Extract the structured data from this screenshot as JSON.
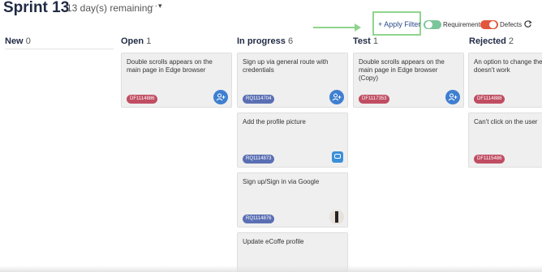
{
  "header": {
    "sprint": "Sprint 13",
    "remaining": "13 day(s) remaining",
    "menu_icon": "ellipsis-icon",
    "caret_icon": "caret-down-icon"
  },
  "toolbar": {
    "apply_filter": "+ Apply Filter",
    "requirements_label": "Requirements",
    "defects_label": "Defects",
    "requirements_on": true,
    "defects_on": true,
    "refresh_icon": "refresh-icon"
  },
  "colors": {
    "highlight": "#8fd48c",
    "defect_tag": "#c04d62",
    "requirement_tag": "#5a6fb3",
    "toggle_requirements": "#7bc59a",
    "toggle_defects": "#e2563c"
  },
  "columns": [
    {
      "name": "New",
      "count": "0"
    },
    {
      "name": "Open",
      "count": "1"
    },
    {
      "name": "In progress",
      "count": "6"
    },
    {
      "name": "Test",
      "count": "1"
    },
    {
      "name": "Rejected",
      "count": "2"
    }
  ],
  "cards": {
    "open": [
      {
        "title": "Double scrolls appears on the main page in Edge browser",
        "id": "DF1114886",
        "avatar": "add-assignee-icon"
      }
    ],
    "in_progress": [
      {
        "title": "Sign up via general route with credentials",
        "id": "RQ1114704",
        "avatar": "add-assignee-icon"
      },
      {
        "title": "Add the profile picture",
        "id": "RQ1114873",
        "avatar": "user-avatar-icon"
      },
      {
        "title": "Sign up/Sign in via Google",
        "id": "RQ1114876",
        "avatar": "user-photo"
      },
      {
        "title": "Update eCoffe profile",
        "id": "",
        "avatar": ""
      }
    ],
    "test": [
      {
        "title": "Double scrolls appears on the main page in Edge browser (Copy)",
        "id": "DF1117353",
        "avatar": "add-assignee-icon"
      }
    ],
    "rejected": [
      {
        "title": "An option to change the theme doesn't work",
        "id": "DF1114888",
        "avatar": ""
      },
      {
        "title": "Can't click on the user",
        "id": "DF1115486",
        "avatar": ""
      }
    ]
  }
}
